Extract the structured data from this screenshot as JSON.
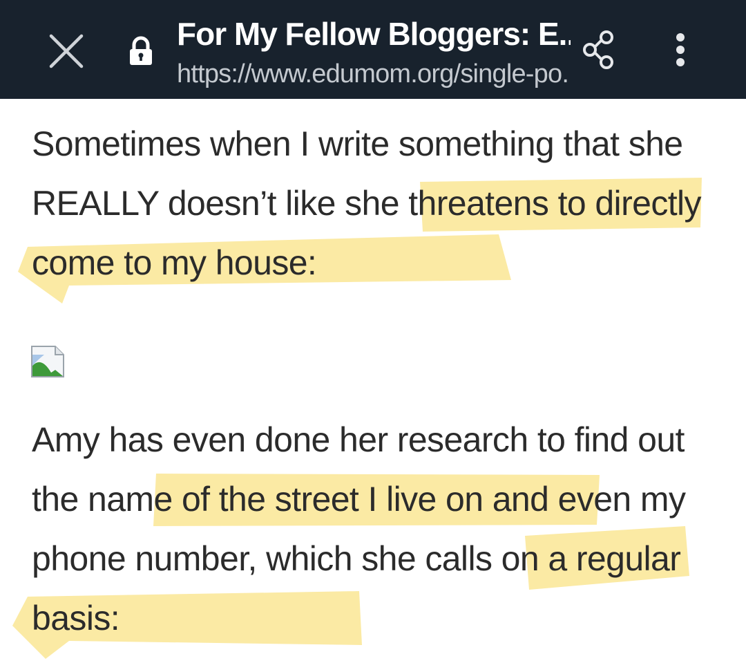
{
  "browser": {
    "title": "For My Fellow Bloggers: E...",
    "url": "https://www.edumom.org/single-po..."
  },
  "article": {
    "paragraph1": {
      "text_before": "Sometimes when I write something that she REALLY doesn’t like ",
      "highlight": "she threatens to directly come to my house:"
    },
    "paragraph2": {
      "text_a": "Amy has even done her research to find out the ",
      "highlight_a": "name of the street I live on ",
      "text_b": "and even my phone number, which ",
      "highlight_b": "she calls on a regular basis:"
    }
  },
  "icons": {
    "close": "close-icon",
    "lock": "lock-icon",
    "share": "share-icon",
    "menu": "more-vert-icon",
    "image": "broken-image-icon"
  },
  "colors": {
    "toolbar_bg": "#18222d",
    "highlight": "#fbeaa4",
    "body_text": "#2b2b2b"
  }
}
